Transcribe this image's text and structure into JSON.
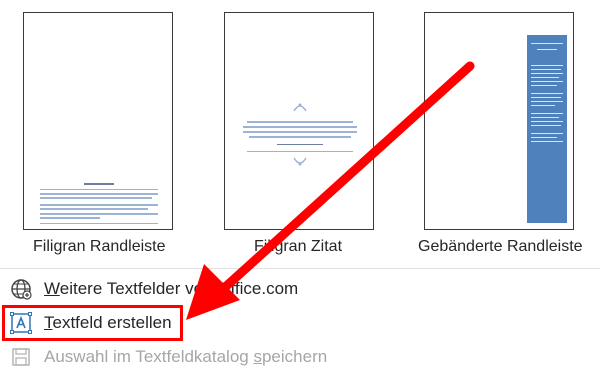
{
  "gallery": {
    "items": [
      {
        "label": "Filigran Randleiste"
      },
      {
        "label": "Filigran Zitat"
      },
      {
        "label": "Gebänderte Randleiste"
      }
    ]
  },
  "menu": {
    "items": [
      {
        "label_underlined": "W",
        "label_rest": "eitere Textfelder von Office.com",
        "icon": "globe-icon",
        "enabled": true
      },
      {
        "label_underlined": "T",
        "label_rest": "extfeld erstellen",
        "icon": "textbox-icon",
        "enabled": true,
        "highlighted": true
      },
      {
        "label_pre": "Auswahl im Textfeldkatalog ",
        "label_underlined": "s",
        "label_rest": "peichern",
        "icon": "save-icon",
        "enabled": false
      }
    ]
  },
  "annotation": {
    "arrow_color": "#ff0000",
    "highlight_color": "#ff0000"
  },
  "colors": {
    "accent_blue": "#4f81bd"
  }
}
